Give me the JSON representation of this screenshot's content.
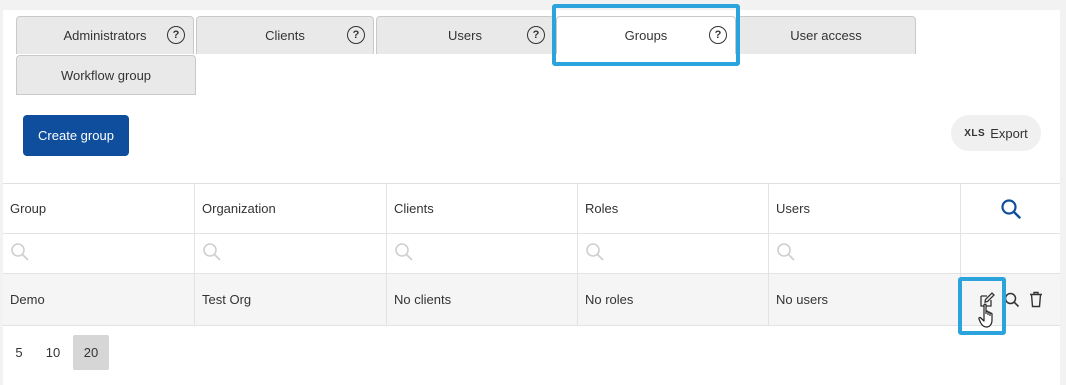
{
  "tabs": [
    {
      "label": "Administrators",
      "help": "?"
    },
    {
      "label": "Clients",
      "help": "?"
    },
    {
      "label": "Users",
      "help": "?"
    },
    {
      "label": "Groups",
      "help": "?"
    },
    {
      "label": "User access"
    },
    {
      "label": "Workflow group"
    }
  ],
  "active_tab": "Groups",
  "toolbar": {
    "create_label": "Create group",
    "export_prefix": "XLS",
    "export_label": "Export"
  },
  "table": {
    "columns": [
      "Group",
      "Organization",
      "Clients",
      "Roles",
      "Users"
    ],
    "rows": [
      {
        "group": "Demo",
        "organization": "Test Org",
        "clients": "No clients",
        "roles": "No roles",
        "users": "No users"
      }
    ]
  },
  "pagination": {
    "sizes": [
      "5",
      "10",
      "20"
    ],
    "selected": "20"
  },
  "colors": {
    "primary": "#0e4e9d",
    "highlight": "#2ba3dd",
    "icon_blue": "#0e4e9d"
  },
  "icons": {
    "header_search": "search-icon",
    "filter_search": "search-icon",
    "edit": "edit-icon",
    "view": "search-icon",
    "delete": "trash-icon",
    "cursor": "hand-pointer-icon"
  }
}
